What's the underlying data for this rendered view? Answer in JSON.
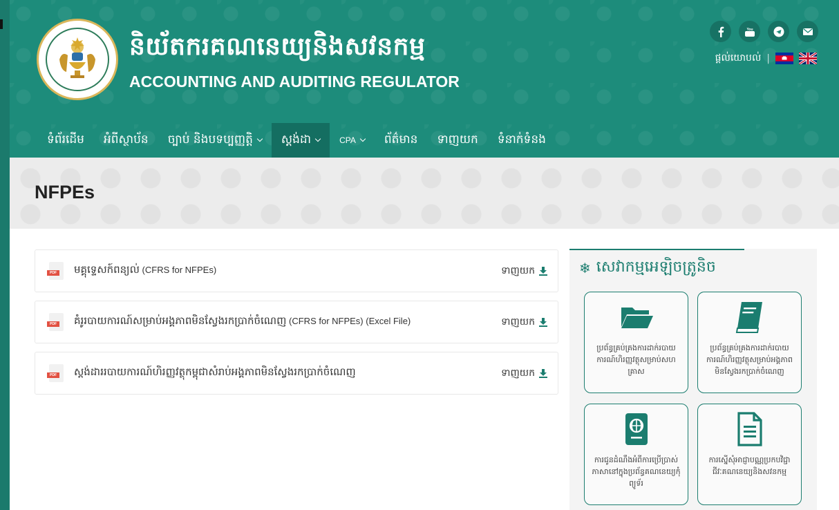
{
  "header": {
    "org_name_kh": "និយ័តករគណនេយ្យនិងសវនកម្ម",
    "org_name_en": "ACCOUNTING AND AUDITING REGULATOR",
    "logo_icon": "aar-emblem-icon",
    "socials": [
      {
        "name": "facebook-icon",
        "glyph": "f"
      },
      {
        "name": "youtube-icon",
        "glyph": "You"
      },
      {
        "name": "telegram-icon",
        "glyph": "➤"
      },
      {
        "name": "email-icon",
        "glyph": "✉"
      }
    ],
    "feedback_label": "ផ្តល់យោបល់",
    "separator": "|",
    "languages": [
      "km",
      "en"
    ]
  },
  "nav": {
    "items": [
      {
        "label": "ទំព័រដើម"
      },
      {
        "label": "អំពីស្ថាប័ន"
      },
      {
        "label": "ច្បាប់ និងបទប្បញ្ញត្តិ"
      },
      {
        "label": "ស្តង់ដា"
      },
      {
        "label": "CPA"
      },
      {
        "label": "ព័ត៌មាន"
      },
      {
        "label": "ទាញយក"
      },
      {
        "label": "ទំនាក់ទំនង"
      }
    ],
    "active": "ស្តង់ដា"
  },
  "banner": {
    "title": "NFPEs"
  },
  "documents": [
    {
      "title_kh": "មគ្គុទ្ទេសក៍ពន្យល់",
      "title_en": " (CFRS for NFPEs)",
      "action": "ទាញយក"
    },
    {
      "title_kh": "គំរូរបាយការណ៍សម្រាប់អង្គភាពមិនស្វែងរកប្រាក់ចំណេញ",
      "title_en": " (CFRS for NFPEs) (Excel File)",
      "action": "ទាញយក"
    },
    {
      "title_kh": "ស្តង់ដាររបាយការណ៍ហិរញ្ញវត្ថុកម្ពុជាសំរាប់អង្គភាពមិនស្វែងរកប្រាក់ចំណេញ",
      "title_en": "",
      "action": "ទាញយក"
    }
  ],
  "sidebar": {
    "title": "សេវាកម្មអេឡិចត្រូនិច",
    "cards": [
      {
        "icon": "folder-open-icon",
        "label": "ប្រព័ន្ធគ្រប់គ្រងការដាក់របាយការណ៍ហិរញ្ញវត្ថុសម្រាប់សហគ្រាស"
      },
      {
        "icon": "book-icon",
        "label": "ប្រព័ន្ធគ្រប់គ្រងការដាក់របាយការណ៍ហិរញ្ញវត្ថុសម្រាប់អង្គភាពមិនស្វែងរកប្រាក់ចំណេញ"
      },
      {
        "icon": "passport-icon",
        "label": "ការជូនដំណឹងអំពីការប្រើប្រាស់ភាសានៅក្នុងប្រព័ន្ធគណនេយ្យកុំព្យូទ័រ"
      },
      {
        "icon": "document-icon",
        "label": "ការស្នើសុំអាជ្ញាបណ្ណប្រកបវិជ្ជាជីវៈគណនេយ្យនិងសវនកម្ម"
      }
    ]
  },
  "colors": {
    "primary": "#1d8c7b",
    "nav_active": "#146e61",
    "accent": "#1b7d6f",
    "pdf_red": "#e25142"
  }
}
